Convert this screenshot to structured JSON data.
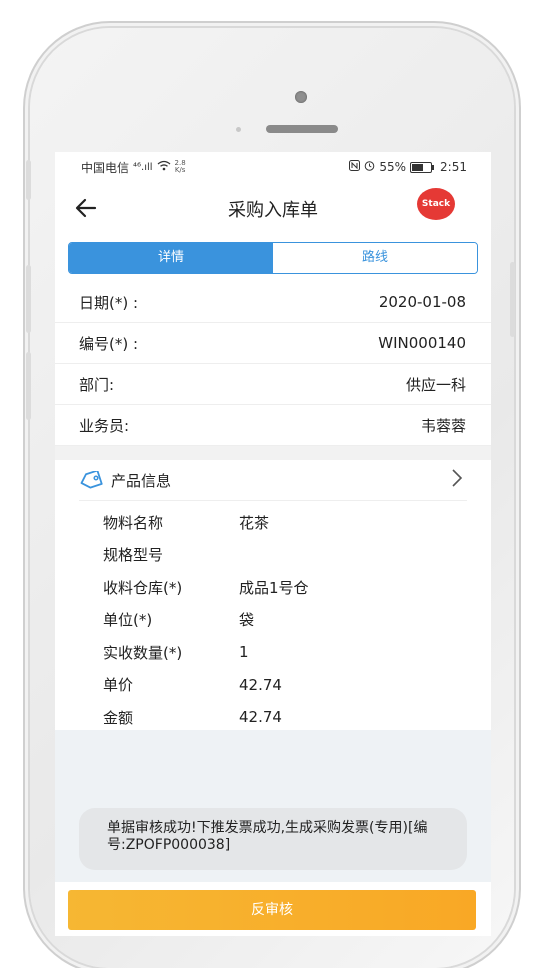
{
  "status_bar": {
    "carrier": "中国电信",
    "signal": "⁴⁶.ıll",
    "speed_value": "2.8",
    "speed_unit": "K/s",
    "battery_percent": "55%",
    "time": "2:51"
  },
  "header": {
    "back_icon": "arrow-left-icon",
    "title": "采购入库单",
    "stack_label": "Stack",
    "stack_color": "#e53935"
  },
  "tabs": [
    {
      "label": "详情",
      "active": true
    },
    {
      "label": "路线",
      "active": false
    }
  ],
  "form": [
    {
      "label": "日期(*) :",
      "value": "2020-01-08"
    },
    {
      "label": "编号(*) :",
      "value": "WIN000140"
    },
    {
      "label": "部门:",
      "value": "供应一科"
    },
    {
      "label": "业务员:",
      "value": "韦蓉蓉"
    }
  ],
  "product": {
    "header_icon": "tag-icon",
    "title": "产品信息",
    "fields": [
      {
        "key": "物料名称",
        "value": "花茶"
      },
      {
        "key": "规格型号",
        "value": ""
      },
      {
        "key": "收料仓库(*)",
        "value": "成品1号仓"
      },
      {
        "key": "单位(*)",
        "value": "袋"
      },
      {
        "key": "实收数量(*)",
        "value": "1"
      },
      {
        "key": "单价",
        "value": "42.74"
      },
      {
        "key": "金额",
        "value": "42.74"
      }
    ]
  },
  "toast": {
    "message": "单据审核成功!下推发票成功,生成采购发票(专用)[编号:ZPOFP000038]"
  },
  "action": {
    "label": "反审核",
    "color": "#f9a825"
  },
  "theme": {
    "accent": "#3a93dd"
  }
}
